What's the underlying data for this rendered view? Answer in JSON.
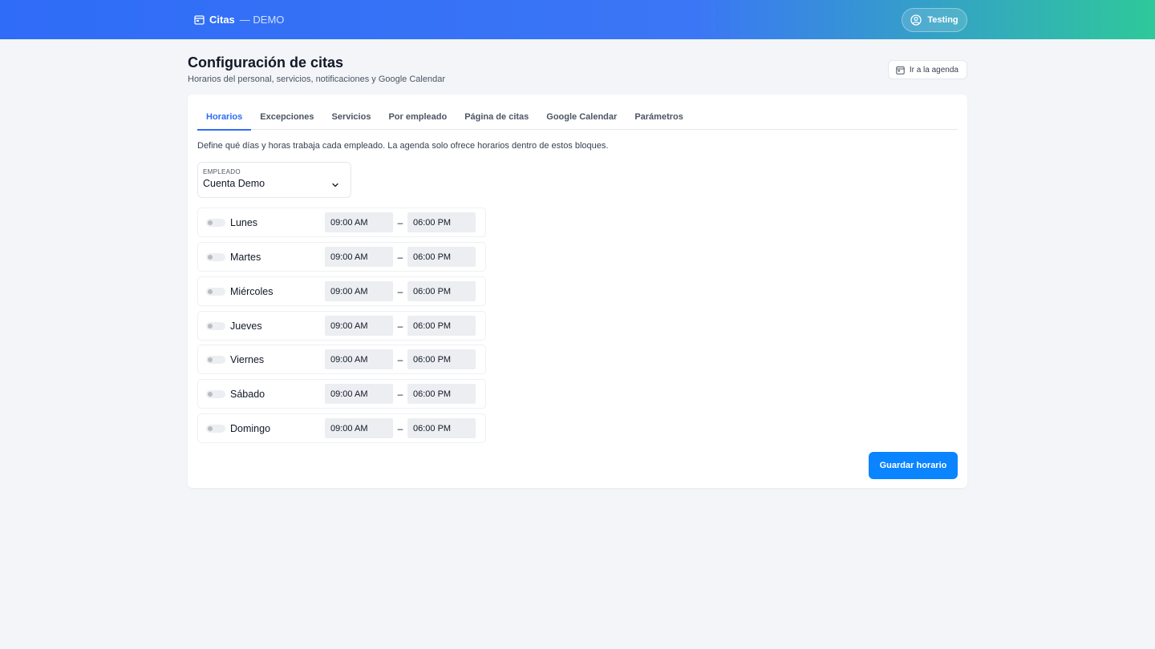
{
  "topbar": {
    "brand_name": "Citas",
    "env_label": "— DEMO",
    "user_name": "Testing"
  },
  "header": {
    "title": "Configuración de citas",
    "subtitle": "Horarios del personal, servicios, notificaciones y Google Calendar",
    "agenda_button": "Ir a la agenda"
  },
  "tabs": [
    {
      "label": "Horarios",
      "active": true
    },
    {
      "label": "Excepciones",
      "active": false
    },
    {
      "label": "Servicios",
      "active": false
    },
    {
      "label": "Por empleado",
      "active": false
    },
    {
      "label": "Página de citas",
      "active": false
    },
    {
      "label": "Google Calendar",
      "active": false
    },
    {
      "label": "Parámetros",
      "active": false
    }
  ],
  "schedule": {
    "description": "Define qué días y horas trabaja cada empleado. La agenda solo ofrece horarios dentro de estos bloques.",
    "employee_label": "EMPLEADO",
    "employee_value": "Cuenta Demo",
    "separator": "–",
    "days": [
      {
        "name": "Lunes",
        "enabled": false,
        "start": "09:00 AM",
        "end": "06:00 PM"
      },
      {
        "name": "Martes",
        "enabled": false,
        "start": "09:00 AM",
        "end": "06:00 PM"
      },
      {
        "name": "Miércoles",
        "enabled": false,
        "start": "09:00 AM",
        "end": "06:00 PM"
      },
      {
        "name": "Jueves",
        "enabled": false,
        "start": "09:00 AM",
        "end": "06:00 PM"
      },
      {
        "name": "Viernes",
        "enabled": false,
        "start": "09:00 AM",
        "end": "06:00 PM"
      },
      {
        "name": "Sábado",
        "enabled": false,
        "start": "09:00 AM",
        "end": "06:00 PM"
      },
      {
        "name": "Domingo",
        "enabled": false,
        "start": "09:00 AM",
        "end": "06:00 PM"
      }
    ],
    "save_button": "Guardar horario"
  },
  "colors": {
    "primary": "#2f6cf7",
    "save_button": "#0a84ff",
    "gradient_end": "#2ec99a",
    "background": "#f3f5f8"
  }
}
